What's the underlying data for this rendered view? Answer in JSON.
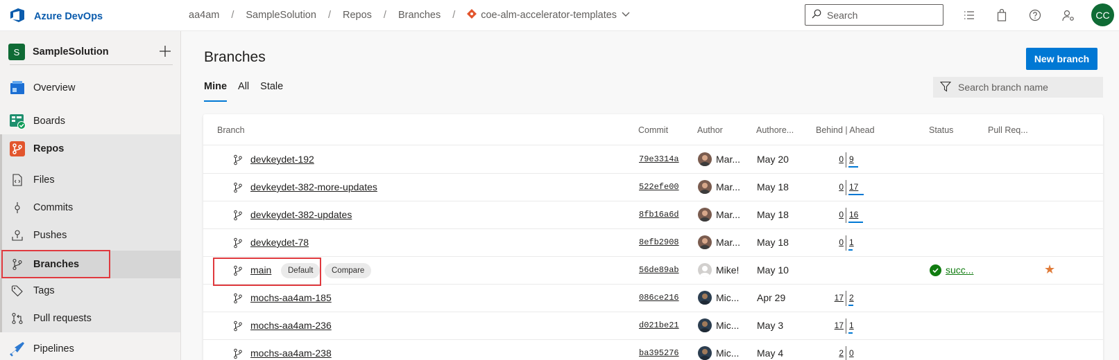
{
  "header": {
    "brand": "Azure DevOps",
    "breadcrumbs": [
      "aa4am",
      "SampleSolution",
      "Repos",
      "Branches"
    ],
    "repo_name": "coe-alm-accelerator-templates",
    "search_placeholder": "Search",
    "user_initials": "CC"
  },
  "sidebar": {
    "project_initial": "S",
    "project_name": "SampleSolution",
    "items": {
      "overview": "Overview",
      "boards": "Boards",
      "repos": "Repos",
      "files": "Files",
      "commits": "Commits",
      "pushes": "Pushes",
      "branches": "Branches",
      "tags": "Tags",
      "pull_requests": "Pull requests",
      "pipelines": "Pipelines"
    }
  },
  "main": {
    "title": "Branches",
    "new_branch_label": "New branch",
    "tabs": [
      "Mine",
      "All",
      "Stale"
    ],
    "filter_placeholder": "Search branch name",
    "columns": {
      "branch": "Branch",
      "commit": "Commit",
      "author": "Author",
      "authored": "Authore...",
      "behind_ahead": "Behind | Ahead",
      "status": "Status",
      "pull_request": "Pull Req..."
    },
    "rows": [
      {
        "name": "devkeydet-192",
        "commit": "79e3314a",
        "author": "Mar...",
        "date": "May 20",
        "behind": "0",
        "ahead": "9",
        "ahead_fraction": 0.55
      },
      {
        "name": "devkeydet-382-more-updates",
        "commit": "522efe00",
        "author": "Mar...",
        "date": "May 18",
        "behind": "0",
        "ahead": "17",
        "ahead_fraction": 1.0
      },
      {
        "name": "devkeydet-382-updates",
        "commit": "8fb16a6d",
        "author": "Mar...",
        "date": "May 18",
        "behind": "0",
        "ahead": "16",
        "ahead_fraction": 0.95
      },
      {
        "name": "devkeydet-78",
        "commit": "8efb2908",
        "author": "Mar...",
        "date": "May 18",
        "behind": "0",
        "ahead": "1",
        "ahead_fraction": 0.1
      },
      {
        "name": "main",
        "default_label": "Default",
        "compare_label": "Compare",
        "commit": "56de89ab",
        "author": "Mike!",
        "date": "May 10",
        "behind": "",
        "ahead": "",
        "status": "succ...",
        "favorite": true
      },
      {
        "name": "mochs-aa4am-185",
        "commit": "086ce216",
        "author": "Mic...",
        "date": "Apr 29",
        "behind": "17",
        "ahead": "2",
        "ahead_fraction": 0.15
      },
      {
        "name": "mochs-aa4am-236",
        "commit": "d021be21",
        "author": "Mic...",
        "date": "May 3",
        "behind": "17",
        "ahead": "1",
        "ahead_fraction": 0.1
      },
      {
        "name": "mochs-aa4am-238",
        "commit": "ba395276",
        "author": "Mic...",
        "date": "May 4",
        "behind": "2",
        "ahead": "0",
        "ahead_fraction": 0
      }
    ]
  },
  "colors": {
    "accent": "#0078d4",
    "brand_green": "#0f6b35",
    "success": "#107c10",
    "favorite": "#e07b39",
    "highlight_box": "#e0393e"
  }
}
